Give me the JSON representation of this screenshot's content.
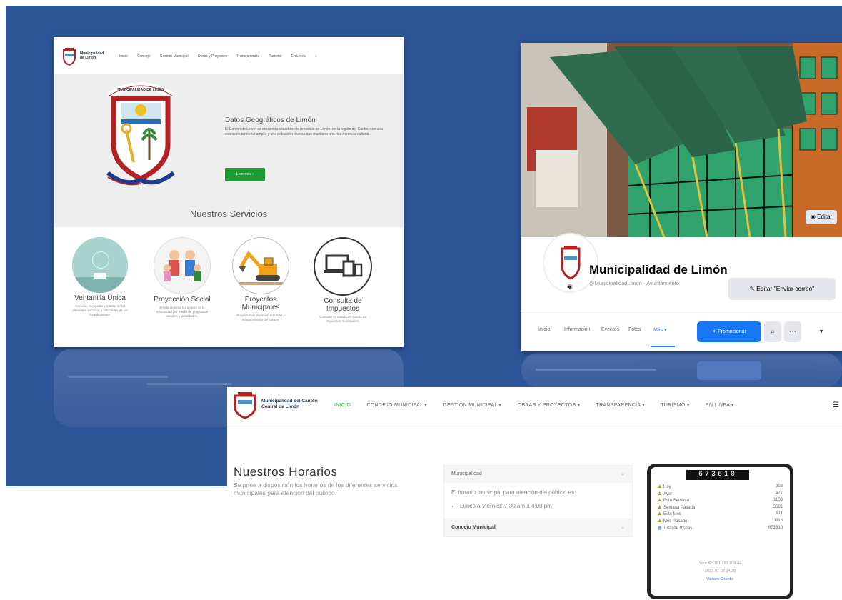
{
  "screenshot_a": {
    "brand": "Municipalidad de Limón",
    "nav_items": [
      "Inicio",
      "Concejo",
      "Gestión Municipal",
      "Obras y Proyectos",
      "Transparencia",
      "Turismo",
      "En Línea"
    ],
    "crest_ribbon": "MUNICIPALIDAD DE LIMON",
    "hero_title": "Datos Geográficos de Limón",
    "hero_text": "El Cantón de Limón se encuentra situado en la provincia de Limón, en la región del Caribe, con una extensión territorial amplia y una población diversa que mantiene una rica herencia cultural.",
    "hero_button": "Leer más ›",
    "services_title": "Nuestros Servicios",
    "services": [
      {
        "title": "Ventanilla Única",
        "desc": "Atención, recepción y trámite de los diferentes servicios y solicitudes de los contribuyentes."
      },
      {
        "title": "Proyección Social",
        "desc": "Brinda apoyo a los grupos de la comunidad por medio de programas sociales y actividades."
      },
      {
        "title": "Proyectos Municipales",
        "desc": "Proyectos de inversión en obras y mantenimiento del cantón."
      },
      {
        "title": "Consulta de Impuestos",
        "desc": "Consulte su estado de cuenta de impuestos municipales."
      }
    ]
  },
  "screenshot_b": {
    "edit_cover": "Editar",
    "page_name": "Municipalidad de Limón",
    "handle": "@MunicipalidadLimon · Ayuntamiento",
    "edit_as_button": "✎ Editar \"Enviar correo\"",
    "tabs": [
      "Inicio",
      "Información",
      "Eventos",
      "Fotos",
      "Más ▾"
    ],
    "promote_button": "Promocionar",
    "search_icon_glyph": "⌕",
    "more_glyph": "···"
  },
  "screenshot_c": {
    "brand": "Municipalidad del Cantón Central de Limón",
    "nav_items": [
      "INICIO",
      "CONCEJO MUNICIPAL ▾",
      "GESTIÓN MUNICIPAL ▾",
      "OBRAS Y PROYECTOS ▾",
      "TRANSPARENCIA ▾",
      "TURISMO ▾",
      "EN LÍNEA ▾"
    ],
    "menu_glyph": "☰",
    "title": "Nuestros Horarios",
    "subtitle": "Se pone a disposición los horarios de los diferentes servicios municipales para atención del público.",
    "accordion": [
      {
        "header": "Municipalidad",
        "body": "El horario municipal para atención del público es:",
        "items": [
          "Lunes a Viernes: 7:30 am a 4:00 pm"
        ]
      },
      {
        "header": "Concejo Municipal"
      }
    ],
    "counter": "673610",
    "stats": [
      {
        "label": "Hoy",
        "value": "208"
      },
      {
        "label": "Ayer",
        "value": "471"
      },
      {
        "label": "Esta Semana",
        "value": "1108"
      },
      {
        "label": "Semana Pasada",
        "value": "3681"
      },
      {
        "label": "Este Mes",
        "value": "911"
      },
      {
        "label": "Mes Pasado",
        "value": "11118"
      },
      {
        "label": "Total de Visitas",
        "value": "673610"
      }
    ],
    "widget_footer": [
      "Your IP: 181.193.106.44",
      "2023-07-02 14:28",
      "Visitors Counter"
    ]
  }
}
